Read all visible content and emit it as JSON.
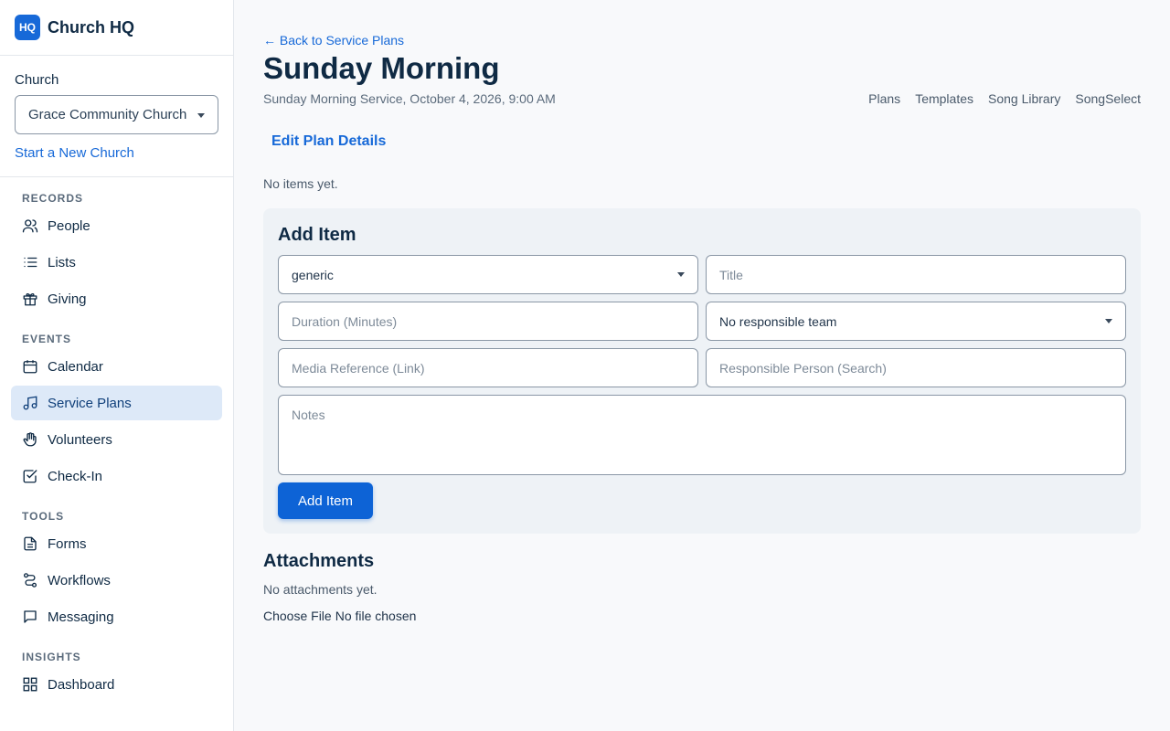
{
  "brand": {
    "logo": "HQ",
    "name": "Church HQ"
  },
  "church": {
    "label": "Church",
    "selected": "Grace Community Church",
    "start_link": "Start a New Church"
  },
  "nav": {
    "records_label": "RECORDS",
    "people": "People",
    "lists": "Lists",
    "giving": "Giving",
    "events_label": "EVENTS",
    "calendar": "Calendar",
    "service_plans": "Service Plans",
    "volunteers": "Volunteers",
    "checkin": "Check-In",
    "tools_label": "TOOLS",
    "forms": "Forms",
    "workflows": "Workflows",
    "messaging": "Messaging",
    "insights_label": "INSIGHTS",
    "dashboard": "Dashboard"
  },
  "header": {
    "back_link": "← Back to Service Plans",
    "title": "Sunday Morning",
    "subtitle": "Sunday Morning Service, October 4, 2026, 9:00 AM",
    "links": {
      "plans": "Plans",
      "templates": "Templates",
      "song_library": "Song Library",
      "songselect": "SongSelect"
    },
    "edit_link": "Edit Plan Details",
    "empty_items": "No items yet."
  },
  "add_item": {
    "heading": "Add Item",
    "type_value": "generic",
    "title_placeholder": "Title",
    "duration_placeholder": "Duration (Minutes)",
    "team_value": "No responsible team",
    "media_placeholder": "Media Reference (Link)",
    "person_placeholder": "Responsible Person (Search)",
    "notes_placeholder": "Notes",
    "submit_label": "Add Item"
  },
  "attachments": {
    "heading": "Attachments",
    "empty": "No attachments yet.",
    "choose_file": "Choose File",
    "no_file": "No file chosen"
  },
  "colors": {
    "accent": "#1769d8",
    "active_bg": "#dde9f8",
    "text": "#0f2a44"
  }
}
